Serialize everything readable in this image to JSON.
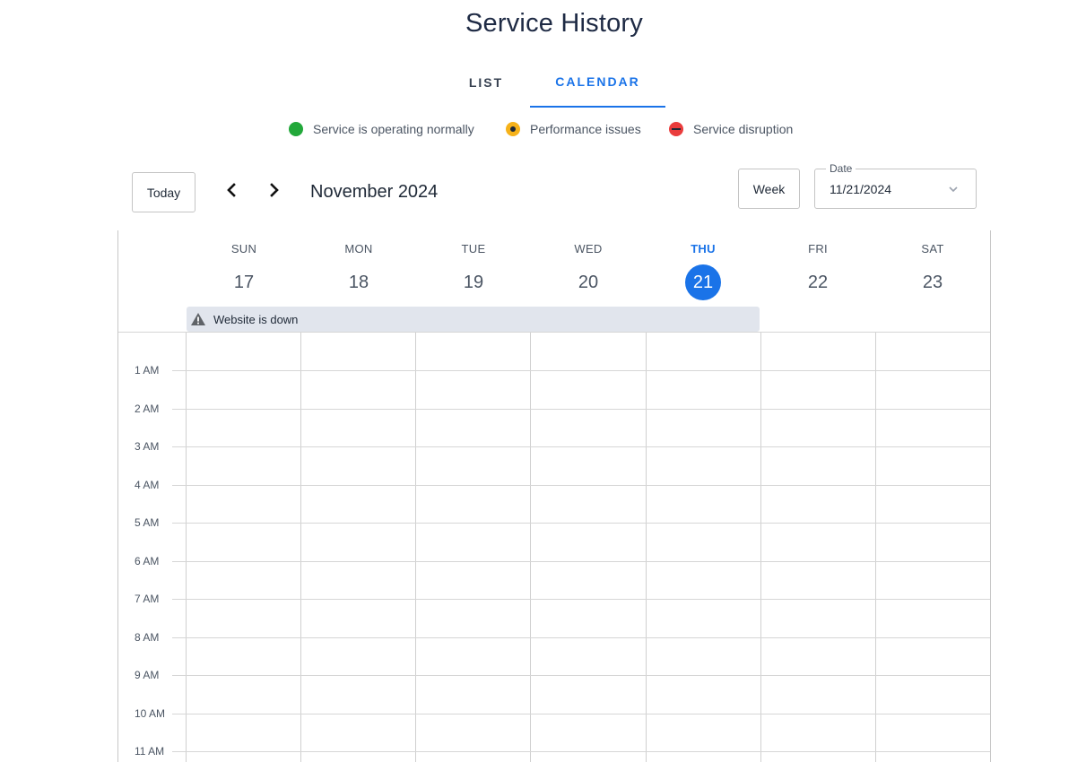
{
  "page": {
    "title": "Service History"
  },
  "tabs": [
    {
      "label": "LIST",
      "active": false
    },
    {
      "label": "CALENDAR",
      "active": true
    }
  ],
  "legend": [
    {
      "label": "Service is operating normally",
      "color": "#22a83a",
      "icon": "green-circle-icon"
    },
    {
      "label": "Performance issues",
      "color": "#f6b21a",
      "icon": "yellow-dot-circle-icon"
    },
    {
      "label": "Service disruption",
      "color": "#ea3c3c",
      "icon": "red-minus-circle-icon"
    }
  ],
  "toolbar": {
    "today_label": "Today",
    "prev_icon": "chevron-left-icon",
    "next_icon": "chevron-right-icon",
    "month_label": "November 2024",
    "view_label": "Week",
    "date_field_label": "Date",
    "date_value": "11/21/2024",
    "date_dropdown_icon": "chevron-down-icon"
  },
  "days": [
    {
      "name": "SUN",
      "num": "17",
      "today": false
    },
    {
      "name": "MON",
      "num": "18",
      "today": false
    },
    {
      "name": "TUE",
      "num": "19",
      "today": false
    },
    {
      "name": "WED",
      "num": "20",
      "today": false
    },
    {
      "name": "THU",
      "num": "21",
      "today": true
    },
    {
      "name": "FRI",
      "num": "22",
      "today": false
    },
    {
      "name": "SAT",
      "num": "23",
      "today": false
    }
  ],
  "all_day_event": {
    "title": "Website is down",
    "icon": "warning-icon",
    "start_day": "SUN",
    "end_day": "WED"
  },
  "hours": [
    "1 AM",
    "2 AM",
    "3 AM",
    "4 AM",
    "5 AM",
    "6 AM",
    "7 AM",
    "8 AM",
    "9 AM",
    "10 AM",
    "11 AM"
  ],
  "colors": {
    "accent": "#1a73e8",
    "event_bg": "#e1e5ed"
  }
}
